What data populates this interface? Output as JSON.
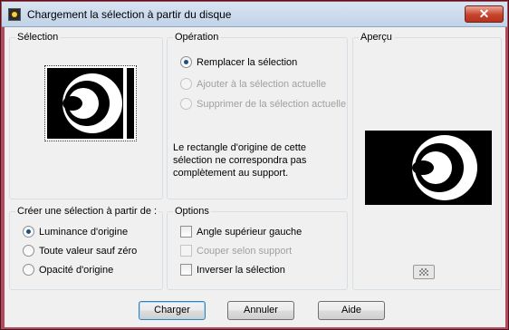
{
  "window": {
    "title": "Chargement la sélection à partir du disque",
    "close_symbol": "✕"
  },
  "selection": {
    "title": "Sélection"
  },
  "operation": {
    "title": "Opération",
    "options": [
      {
        "label": "Remplacer la sélection",
        "checked": true,
        "enabled": true
      },
      {
        "label": "Ajouter à la sélection actuelle",
        "checked": false,
        "enabled": false
      },
      {
        "label": "Supprimer de la sélection actuelle",
        "checked": false,
        "enabled": false
      }
    ],
    "message": "Le rectangle d'origine de cette sélection ne correspondra pas complètement au support."
  },
  "preview": {
    "title": "Aperçu",
    "button_icon": "checkerboard-icon"
  },
  "create_from": {
    "title": "Créer une sélection à partir de :",
    "options": [
      {
        "label": "Luminance d'origine",
        "checked": true
      },
      {
        "label": "Toute valeur sauf zéro",
        "checked": false
      },
      {
        "label": "Opacité d'origine",
        "checked": false
      }
    ]
  },
  "options": {
    "title": "Options",
    "items": [
      {
        "label": "Angle supérieur gauche",
        "checked": false,
        "enabled": true
      },
      {
        "label": "Couper selon support",
        "checked": false,
        "enabled": false
      },
      {
        "label": "Inverser la sélection",
        "checked": false,
        "enabled": true
      }
    ]
  },
  "buttons": {
    "load": "Charger",
    "cancel": "Annuler",
    "help": "Aide"
  },
  "colors": {
    "frame": "#b14a5c",
    "dialog": "#f0f0f0",
    "radio_on": "#1c5180"
  }
}
